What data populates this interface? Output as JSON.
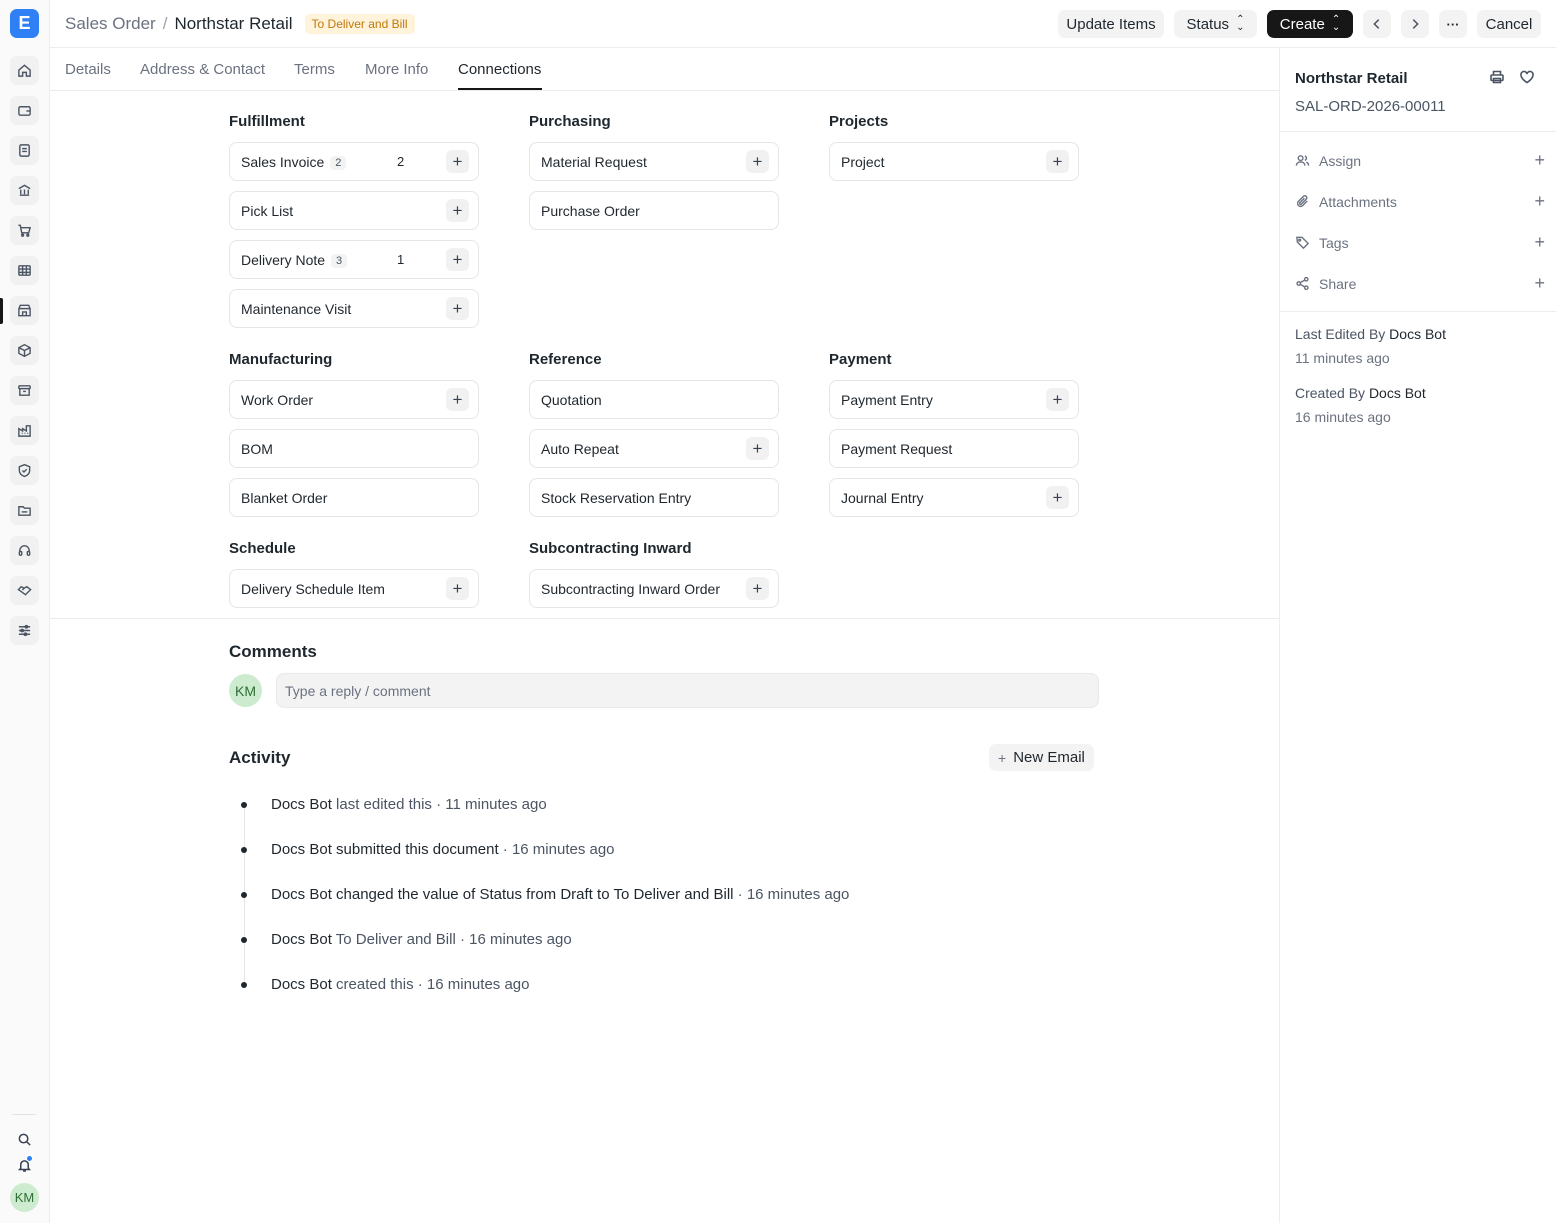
{
  "app": {
    "logo_letter": "E"
  },
  "header": {
    "doctype": "Sales Order",
    "separator": "/",
    "title": "Northstar Retail",
    "status": "To Deliver and Bill",
    "update_items": "Update Items",
    "status_btn": "Status",
    "create_btn": "Create",
    "cancel_btn": "Cancel",
    "more": "···"
  },
  "tabs": [
    "Details",
    "Address & Contact",
    "Terms",
    "More Info",
    "Connections"
  ],
  "active_tab": "Connections",
  "connections": {
    "fulfillment": {
      "title": "Fulfillment",
      "items": [
        {
          "label": "Sales Invoice",
          "badge": "2",
          "open": "2"
        },
        {
          "label": "Pick List"
        },
        {
          "label": "Delivery Note",
          "badge": "3",
          "open": "1"
        },
        {
          "label": "Maintenance Visit"
        }
      ]
    },
    "purchasing": {
      "title": "Purchasing",
      "items": [
        {
          "label": "Material Request"
        },
        {
          "label": "Purchase Order"
        }
      ]
    },
    "projects": {
      "title": "Projects",
      "items": [
        {
          "label": "Project"
        }
      ]
    },
    "manufacturing": {
      "title": "Manufacturing",
      "items": [
        {
          "label": "Work Order"
        },
        {
          "label": "BOM"
        },
        {
          "label": "Blanket Order"
        }
      ]
    },
    "reference": {
      "title": "Reference",
      "items": [
        {
          "label": "Quotation"
        },
        {
          "label": "Auto Repeat"
        },
        {
          "label": "Stock Reservation Entry"
        }
      ]
    },
    "payment": {
      "title": "Payment",
      "items": [
        {
          "label": "Payment Entry"
        },
        {
          "label": "Payment Request"
        },
        {
          "label": "Journal Entry"
        }
      ]
    },
    "schedule": {
      "title": "Schedule",
      "items": [
        {
          "label": "Delivery Schedule Item"
        }
      ]
    },
    "subcontracting": {
      "title": "Subcontracting Inward",
      "items": [
        {
          "label": "Subcontracting Inward Order"
        }
      ]
    }
  },
  "add_symbol": "+",
  "comments": {
    "title": "Comments",
    "avatar": "KM",
    "placeholder": "Type a reply / comment"
  },
  "activity": {
    "title": "Activity",
    "new_email": "New Email",
    "new_email_plus": "+",
    "entries": [
      {
        "user": "Docs Bot",
        "text": " last edited this",
        "time": " · 11 minutes ago"
      },
      {
        "user": "Docs Bot",
        "text": " submitted this document",
        "time": " · 16 minutes ago"
      },
      {
        "user": "Docs Bot",
        "text_pre": " changed the value of Status from ",
        "from": "Draft",
        "mid": " to ",
        "to": "To Deliver and Bill",
        "time": " · 16 minutes ago"
      },
      {
        "user": "Docs Bot",
        "text": " To Deliver and Bill",
        "time": " · 16 minutes ago"
      },
      {
        "user": "Docs Bot",
        "text": " created this",
        "time": " · 16 minutes ago"
      }
    ]
  },
  "sidebar": {
    "title": "Northstar Retail",
    "doc_id": "SAL-ORD-2026-00011",
    "actions": [
      "Assign",
      "Attachments",
      "Tags",
      "Share"
    ],
    "last_edited_label": "Last Edited By",
    "last_edited_by": "Docs Bot",
    "last_edited_time": "11 minutes ago",
    "created_label": "Created By",
    "created_by": "Docs Bot",
    "created_time": "16 minutes ago"
  },
  "user_avatar": "KM"
}
